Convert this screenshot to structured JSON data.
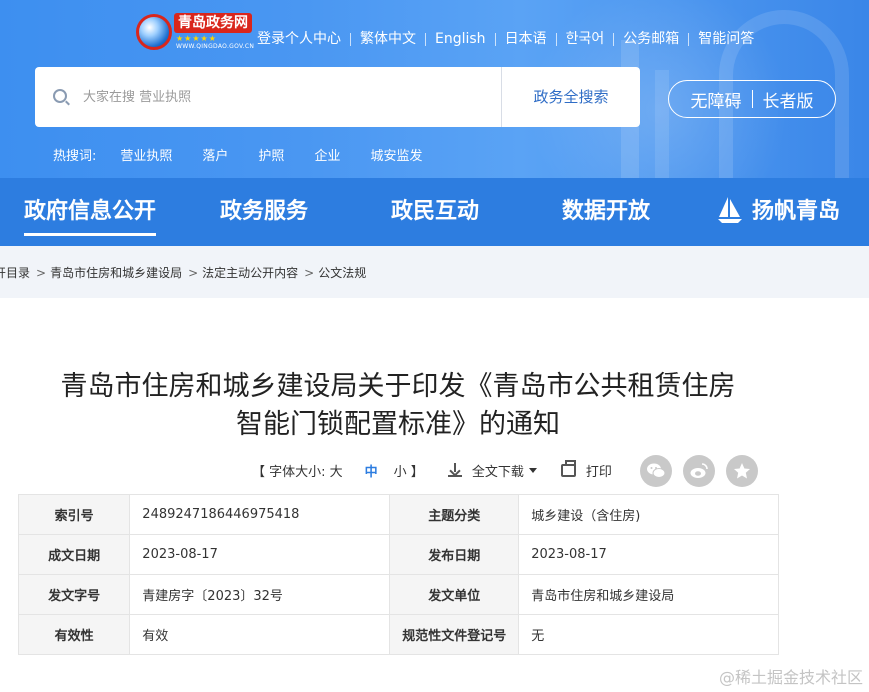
{
  "logo": {
    "name": "青岛政务网",
    "stars": "★★★★★",
    "url": "WWW.QINGDAO.GOV.CN"
  },
  "topnav": [
    "登录个人中心",
    "繁体中文",
    "English",
    "日本语",
    "한국어",
    "公务邮箱",
    "智能问答"
  ],
  "search": {
    "placeholder": "大家在搜 营业执照",
    "button": "政务全搜索"
  },
  "accessibility": {
    "barrier_free": "无障碍",
    "elder": "长者版"
  },
  "hot_search": {
    "label": "热搜词:",
    "keywords": [
      "营业执照",
      "落户",
      "护照",
      "企业",
      "城安监发"
    ]
  },
  "mainnav": [
    "政府信息公开",
    "政务服务",
    "政民互动",
    "数据开放",
    "扬帆青岛"
  ],
  "breadcrumb": [
    "开目录",
    "青岛市住房和城乡建设局",
    "法定主动公开内容",
    "公文法规"
  ],
  "title": {
    "line1": "青岛市住房和城乡建设局关于印发《青岛市公共租赁住房",
    "line2": "智能门锁配置标准》的通知"
  },
  "tools": {
    "font_size_label": "【 字体大小: 大",
    "font_mid": "中",
    "font_small": "小 】",
    "download": "全文下载",
    "print": "打印"
  },
  "info_table": [
    {
      "k1": "索引号",
      "v1": "2489247186446975418",
      "k2": "主题分类",
      "v2": "城乡建设（含住房)"
    },
    {
      "k1": "成文日期",
      "v1": "2023-08-17",
      "k2": "发布日期",
      "v2": "2023-08-17"
    },
    {
      "k1": "发文字号",
      "v1": "青建房字〔2023〕32号",
      "k2": "发文单位",
      "v2": "青岛市住房和城乡建设局"
    },
    {
      "k1": "有效性",
      "v1": "有效",
      "k2": "规范性文件登记号",
      "v2": "无"
    }
  ],
  "watermark": "@稀土掘金技术社区",
  "colors": {
    "header_blue": "#4a97f2",
    "nav_blue": "#2d7de0",
    "link_blue": "#2f6dc6",
    "breadcrumb_bg": "#f1f4f9"
  }
}
